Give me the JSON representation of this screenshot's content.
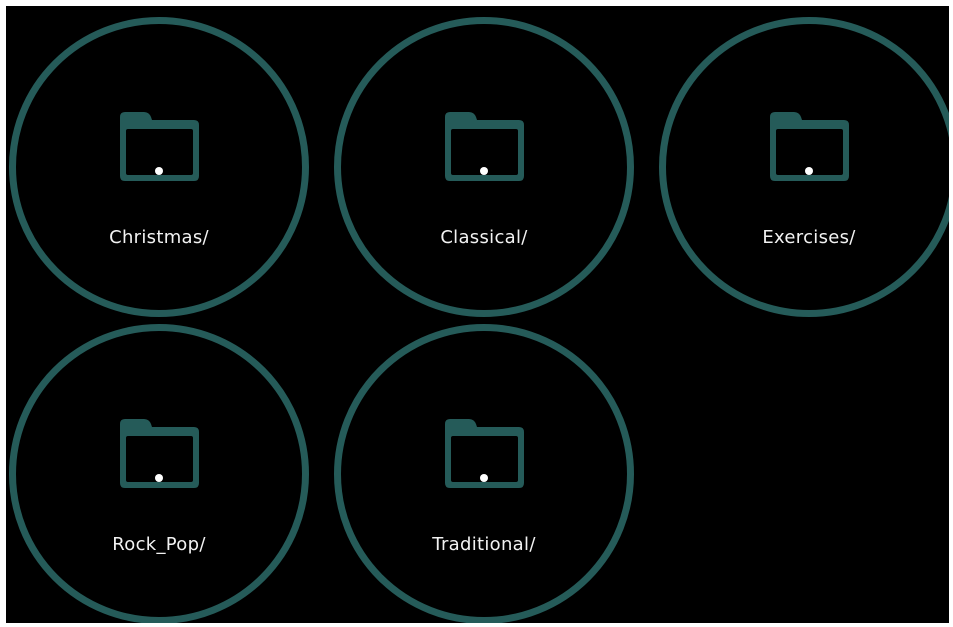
{
  "colors": {
    "background": "#000000",
    "accent": "#255b59",
    "label": "#f2f2f2",
    "indicator": "#ffffff"
  },
  "folders": [
    {
      "label": "Christmas/",
      "icon": "folder-icon"
    },
    {
      "label": "Classical/",
      "icon": "folder-icon"
    },
    {
      "label": "Exercises/",
      "icon": "folder-icon"
    },
    {
      "label": "Rock_Pop/",
      "icon": "folder-icon"
    },
    {
      "label": "Traditional/",
      "icon": "folder-icon"
    }
  ]
}
